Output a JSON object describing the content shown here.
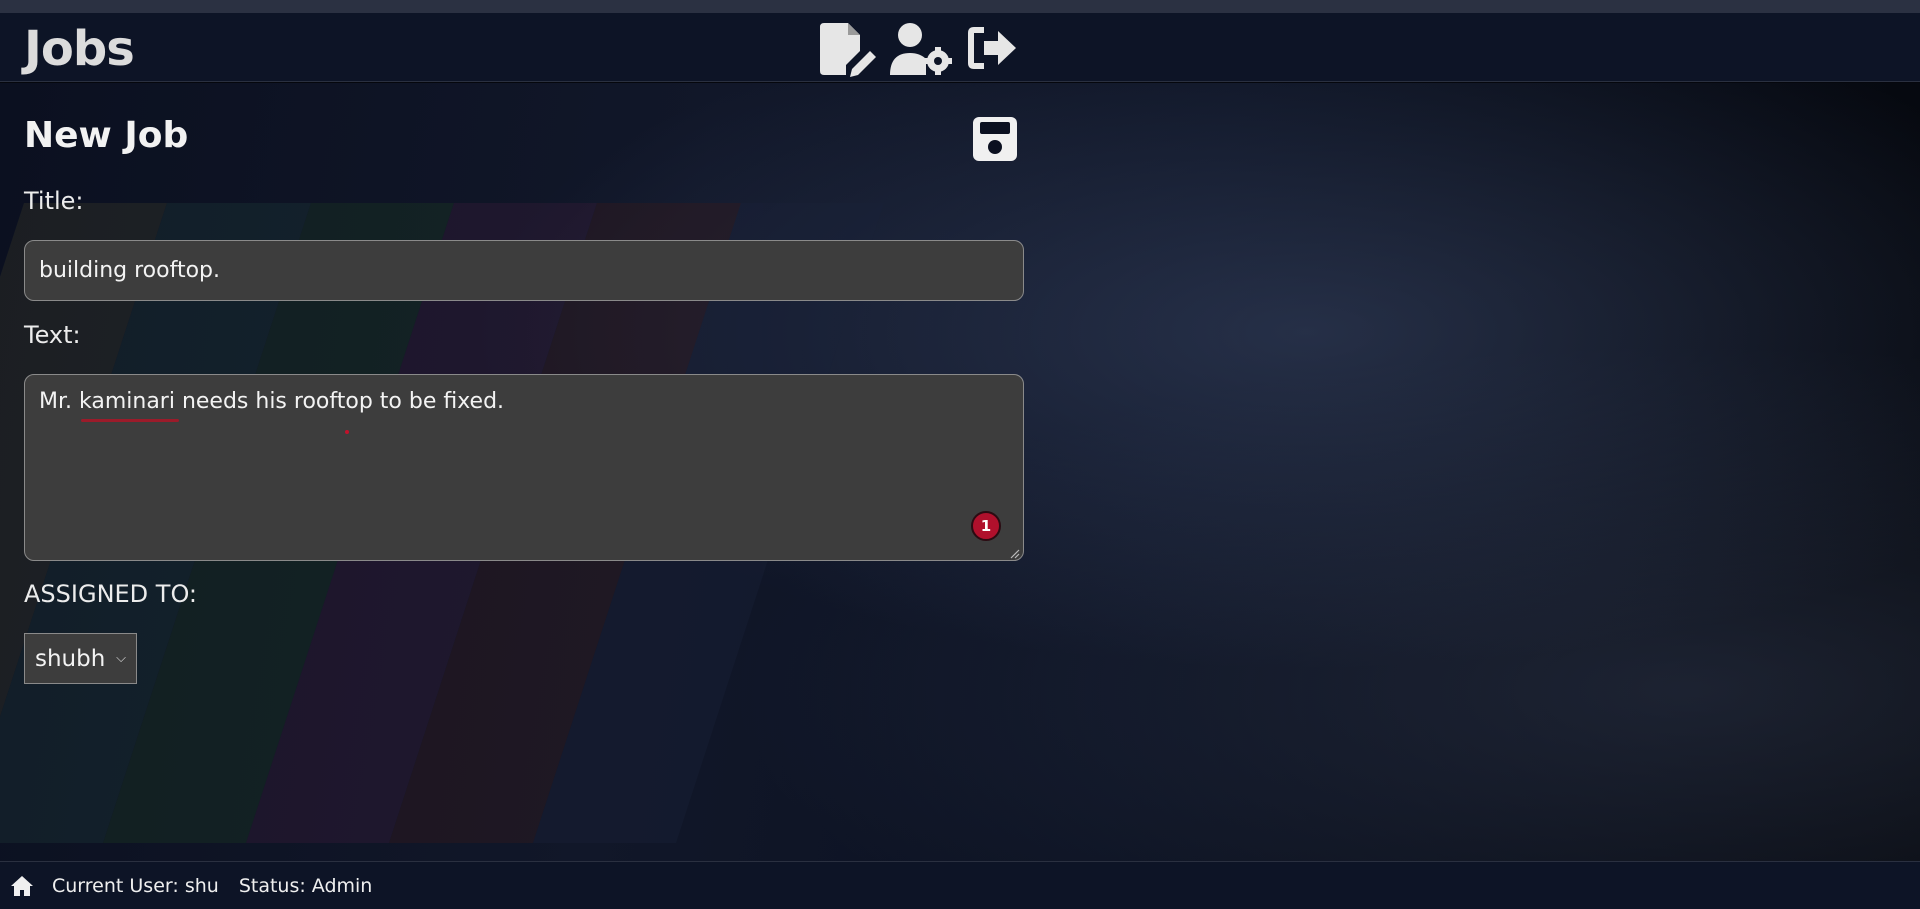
{
  "app": {
    "brand": "Jobs"
  },
  "nav": {
    "icons": [
      "new-document-icon",
      "user-settings-icon",
      "logout-icon"
    ]
  },
  "form": {
    "heading": "New Job",
    "title_label": "Title:",
    "title_value": "building rooftop.",
    "text_label": "Text:",
    "text_value": "Mr. kaminari needs his rooftop to be fixed.",
    "grammar_issue_count": "1",
    "assigned_label": "ASSIGNED TO:",
    "assigned_value": "shubh"
  },
  "footer": {
    "current_user": "Current User: shu",
    "status": "Status: Admin"
  },
  "colors": {
    "navbar": "#0d1426",
    "input_bg": "#3d3d3d",
    "badge": "#b0102c"
  }
}
